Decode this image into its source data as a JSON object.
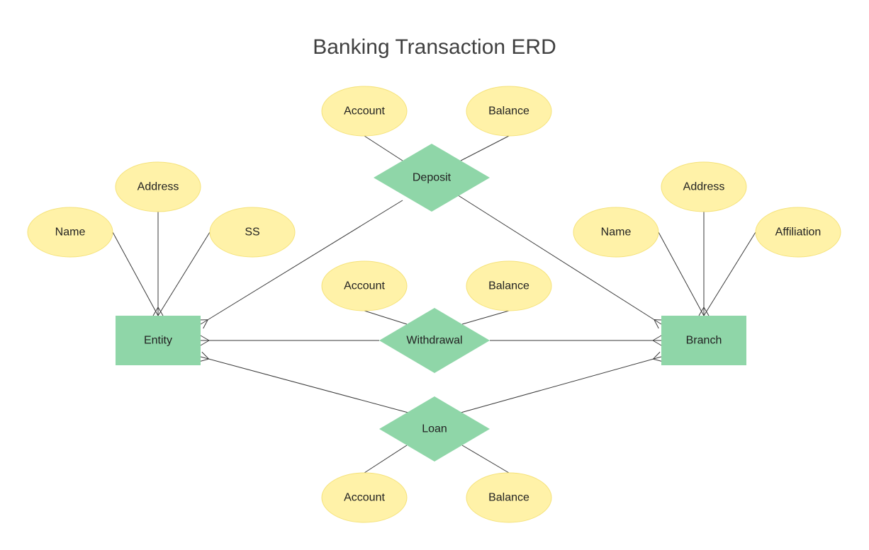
{
  "title": "Banking Transaction ERD",
  "colors": {
    "attribute_fill": "#fff2a8",
    "entity_fill": "#8fd6a8",
    "relationship_fill": "#8fd6a8",
    "line": "#3a3a3a"
  },
  "entities": [
    {
      "id": "entity",
      "label": "Entity"
    },
    {
      "id": "branch",
      "label": "Branch"
    }
  ],
  "relationships": [
    {
      "id": "deposit",
      "label": "Deposit",
      "connects": [
        "entity",
        "branch"
      ],
      "cardinality": "many-to-many"
    },
    {
      "id": "withdrawal",
      "label": "Withdrawal",
      "connects": [
        "entity",
        "branch"
      ],
      "cardinality": "many-to-many"
    },
    {
      "id": "loan",
      "label": "Loan",
      "connects": [
        "entity",
        "branch"
      ],
      "cardinality": "many-to-many"
    }
  ],
  "attributes": [
    {
      "id": "entity-name",
      "label": "Name",
      "owner": "entity"
    },
    {
      "id": "entity-address",
      "label": "Address",
      "owner": "entity"
    },
    {
      "id": "entity-ss",
      "label": "SS",
      "owner": "entity"
    },
    {
      "id": "branch-name",
      "label": "Name",
      "owner": "branch"
    },
    {
      "id": "branch-address",
      "label": "Address",
      "owner": "branch"
    },
    {
      "id": "branch-affiliation",
      "label": "Affiliation",
      "owner": "branch"
    },
    {
      "id": "deposit-account",
      "label": "Account",
      "owner": "deposit"
    },
    {
      "id": "deposit-balance",
      "label": "Balance",
      "owner": "deposit"
    },
    {
      "id": "withdrawal-account",
      "label": "Account",
      "owner": "withdrawal"
    },
    {
      "id": "withdrawal-balance",
      "label": "Balance",
      "owner": "withdrawal"
    },
    {
      "id": "loan-account",
      "label": "Account",
      "owner": "loan"
    },
    {
      "id": "loan-balance",
      "label": "Balance",
      "owner": "loan"
    }
  ]
}
